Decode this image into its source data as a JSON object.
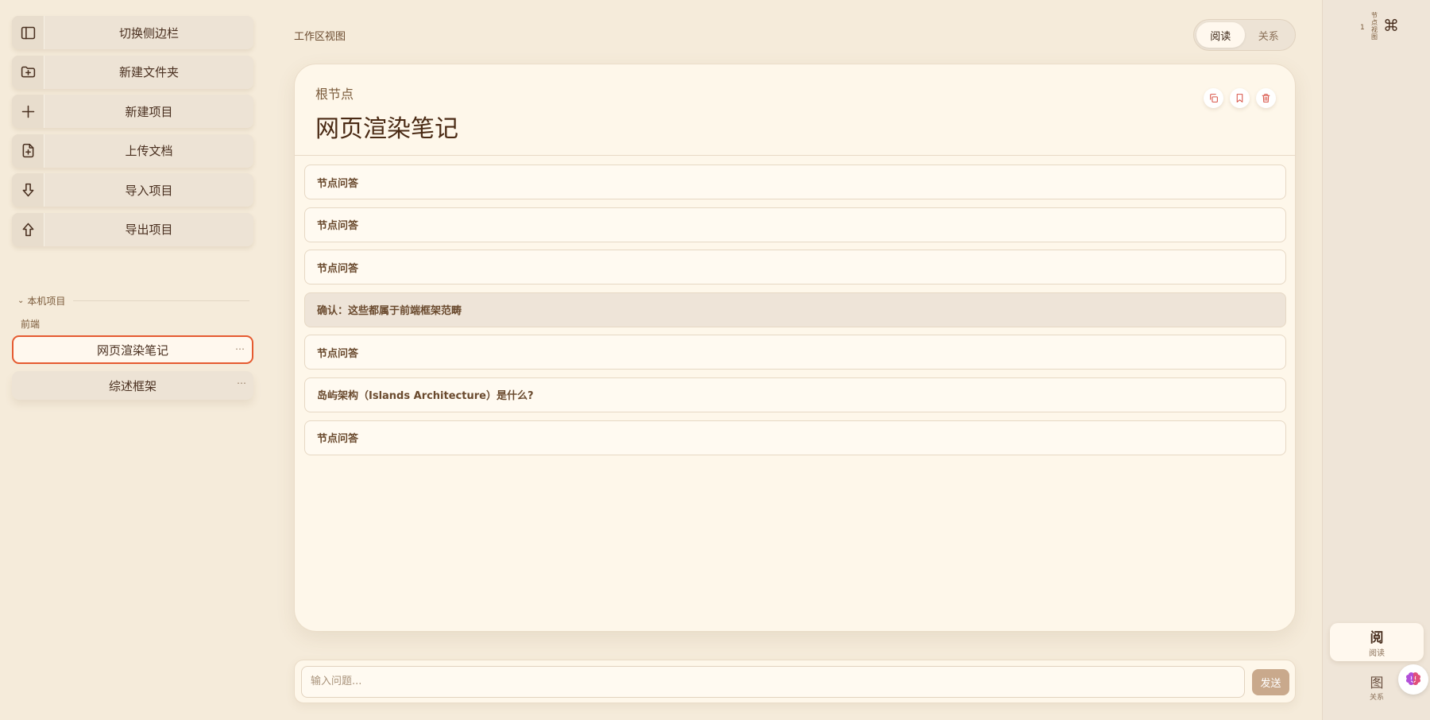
{
  "sidebar": {
    "actions": [
      {
        "label": "切换侧边栏",
        "icon": "sidebar-toggle-icon"
      },
      {
        "label": "新建文件夹",
        "icon": "folder-plus-icon"
      },
      {
        "label": "新建项目",
        "icon": "plus-icon"
      },
      {
        "label": "上传文档",
        "icon": "file-plus-icon"
      },
      {
        "label": "导入项目",
        "icon": "arrow-down-icon"
      },
      {
        "label": "导出项目",
        "icon": "arrow-up-icon"
      }
    ],
    "section": "本机项目",
    "group": "前端",
    "projects": [
      {
        "label": "网页渲染笔记",
        "active": true
      },
      {
        "label": "综述框架",
        "active": false
      }
    ],
    "more_glyph": "⋯"
  },
  "main": {
    "workspace_title": "工作区视图",
    "view_toggle": {
      "read": "阅读",
      "relation": "关系"
    },
    "card": {
      "subtitle": "根节点",
      "title": "网页渲染笔记",
      "items": [
        "节点问答",
        "节点问答",
        "节点问答",
        "确认：这些都属于前端框架范畴",
        "节点问答",
        "岛屿架构（Islands Architecture）是什么?",
        "节点问答"
      ]
    },
    "input": {
      "placeholder": "输入问题...",
      "send": "发送"
    }
  },
  "rail": {
    "count": "1",
    "vertical_label": "节点视图",
    "shortcut": "⌘",
    "read": {
      "big": "阅",
      "small": "阅读"
    },
    "map": {
      "big": "图",
      "small": "关系"
    }
  },
  "colors": {
    "background": "#f5ebda",
    "accent": "#e55a30",
    "danger_icon": "#d9564a",
    "send_button": "#c9a98c"
  }
}
